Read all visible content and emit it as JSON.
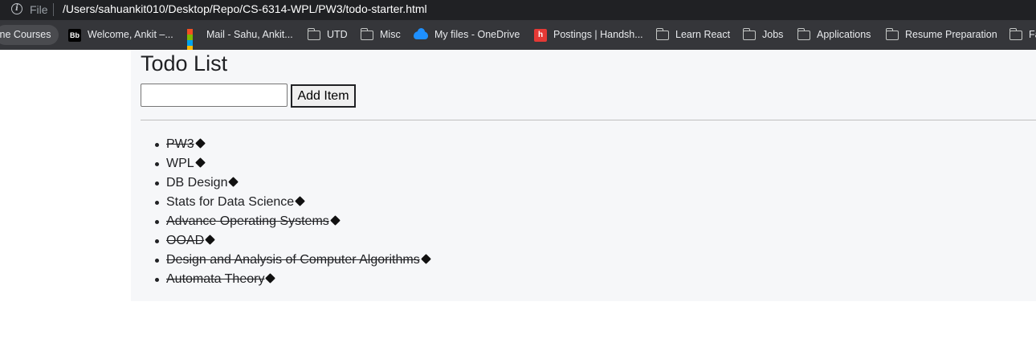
{
  "browser": {
    "scheme_label": "File",
    "url": "/Users/sahuankit010/Desktop/Repo/CS-6314-WPL/PW3/todo-starter.html",
    "bookmarks": [
      {
        "label": "line Courses",
        "icon": "none"
      },
      {
        "label": "Welcome, Ankit –...",
        "icon": "blackboard-icon"
      },
      {
        "label": "Mail - Sahu, Ankit...",
        "icon": "microsoft-icon"
      },
      {
        "label": "UTD",
        "icon": "folder-icon"
      },
      {
        "label": "Misc",
        "icon": "folder-icon"
      },
      {
        "label": "My files - OneDrive",
        "icon": "onedrive-icon"
      },
      {
        "label": "Postings | Handsh...",
        "icon": "handshake-icon"
      },
      {
        "label": "Learn React",
        "icon": "folder-icon"
      },
      {
        "label": "Jobs",
        "icon": "folder-icon"
      },
      {
        "label": "Applications",
        "icon": "folder-icon"
      },
      {
        "label": "Resume Preparation",
        "icon": "folder-icon"
      },
      {
        "label": "Fa",
        "icon": "folder-icon"
      }
    ],
    "icon_glyphs": {
      "blackboard": "Bb",
      "info": "i"
    }
  },
  "page": {
    "title": "Todo List",
    "input_value": "",
    "add_button_label": "Add Item",
    "items": [
      {
        "text": "PW3",
        "done": true
      },
      {
        "text": "WPL",
        "done": false
      },
      {
        "text": "DB Design",
        "done": false
      },
      {
        "text": "Stats for Data Science",
        "done": false
      },
      {
        "text": "Advance Operating Systems",
        "done": true
      },
      {
        "text": "OOAD",
        "done": true
      },
      {
        "text": "Design and Analysis of Computer Algorithms",
        "done": true
      },
      {
        "text": "Automata Theory",
        "done": true
      }
    ]
  },
  "colors": {
    "toolbar_bg": "#202124",
    "bookmarks_bg": "#35363a",
    "page_bg": "#f6f7f9"
  }
}
